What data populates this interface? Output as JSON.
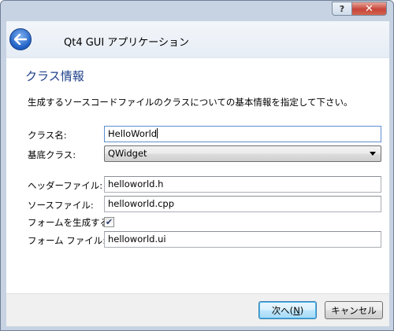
{
  "window": {
    "help_glyph": "?",
    "close_glyph": "✕"
  },
  "header": {
    "title": "Qt4 GUI アプリケーション"
  },
  "page": {
    "heading": "クラス情報",
    "description": "生成するソースコードファイルのクラスについての基本情報を指定して下さい。",
    "class_name": {
      "label": "クラス名:",
      "value": "HelloWorld"
    },
    "base_class": {
      "label": "基底クラス:",
      "value": "QWidget"
    },
    "header_file": {
      "label": "ヘッダーファイル:",
      "value": "helloworld.h"
    },
    "source_file": {
      "label": "ソースファイル:",
      "value": "helloworld.cpp"
    },
    "generate_form": {
      "label": "フォームを生成する:",
      "checked": true,
      "check_glyph": "✔"
    },
    "form_file": {
      "label": "フォーム ファイル:",
      "value": "helloworld.ui"
    }
  },
  "footer": {
    "next_prefix": "次へ(",
    "next_mnemonic": "N",
    "next_suffix": ")",
    "cancel_label": "キャンセル"
  }
}
